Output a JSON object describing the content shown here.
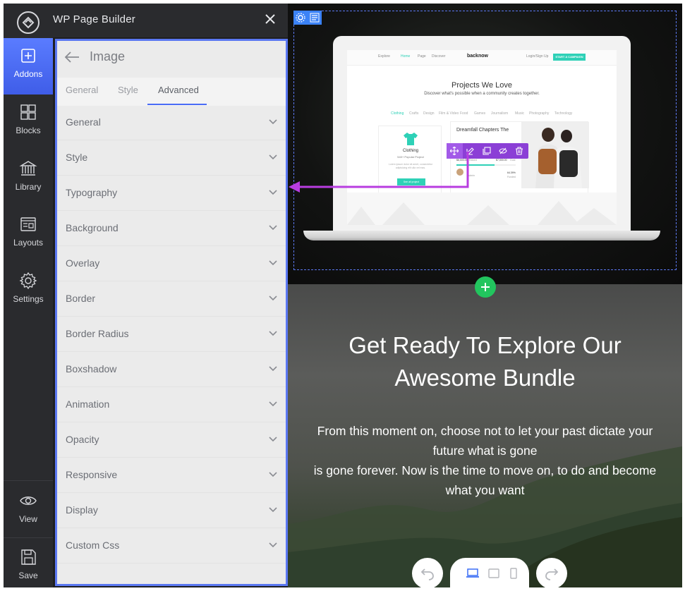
{
  "app": {
    "title": "WP Page Builder"
  },
  "rail": {
    "items": [
      {
        "label": "Addons",
        "icon": "plus-square-icon",
        "active": true
      },
      {
        "label": "Blocks",
        "icon": "blocks-icon",
        "active": false
      },
      {
        "label": "Library",
        "icon": "library-icon",
        "active": false
      },
      {
        "label": "Layouts",
        "icon": "layouts-icon",
        "active": false
      },
      {
        "label": "Settings",
        "icon": "gear-icon",
        "active": false
      }
    ],
    "bottom": [
      {
        "label": "View",
        "icon": "eye-icon"
      },
      {
        "label": "Save",
        "icon": "save-icon"
      }
    ]
  },
  "panel": {
    "element_title": "Image",
    "tabs": [
      {
        "label": "General",
        "active": false
      },
      {
        "label": "Style",
        "active": false
      },
      {
        "label": "Advanced",
        "active": true
      }
    ],
    "sections": [
      "General",
      "Style",
      "Typography",
      "Background",
      "Overlay",
      "Border",
      "Border Radius",
      "Boxshadow",
      "Animation",
      "Opacity",
      "Responsive",
      "Display",
      "Custom Css"
    ]
  },
  "canvas": {
    "hero": {
      "heading_line1": "Get Ready To Explore Our",
      "heading_line2": "Awesome Bundle",
      "body_line1": "From this moment on, choose not to let your past dictate your",
      "body_line2": "future what is gone",
      "body_line3": "is gone forever. Now is the time to move on, to do and become",
      "body_line4": "what you want"
    },
    "mockup": {
      "brand": "backnow",
      "nav": [
        "Explore",
        "Home",
        "Page",
        "Discover"
      ],
      "login": "Login/Sign Up",
      "cta": "START A CAMPAIGN",
      "heading": "Projects We Love",
      "subheading": "Discover what's possible when a community creates together.",
      "categories": [
        "Clothing",
        "Crafts",
        "Design",
        "Film & Video",
        "Food",
        "Games",
        "Journalism",
        "Music",
        "Photography",
        "Technology"
      ],
      "card1": {
        "title": "Clothing",
        "subtitle": "540+ Popular Project",
        "text": "Lorem ipsum dolor sit amet, consectetur adipisicing elit ulla vel mas.",
        "button": "See all project"
      },
      "card2": {
        "title": "Dreamfall Chapters The",
        "raised": "$6,000.00",
        "raised_label": "Raised",
        "goal": "$7,000.00",
        "goal_label": "Goal",
        "percent": "64.39%",
        "percent_label": "Funded",
        "author": "Admin",
        "progress": 0.64
      }
    }
  },
  "colors": {
    "accent": "#4a6cf7",
    "toolbar": "#8b3fd6",
    "add": "#22c55e",
    "teal": "#2ed1b7"
  }
}
